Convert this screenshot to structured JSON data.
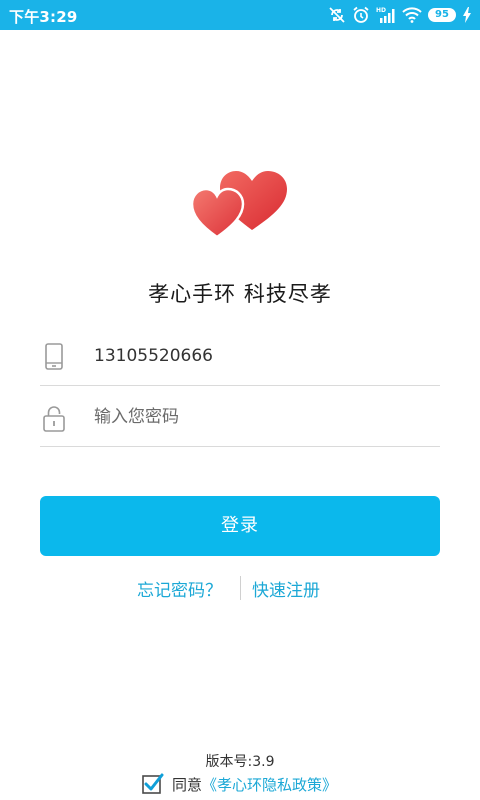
{
  "status_bar": {
    "time": "下午3:29",
    "battery": "95",
    "icons": [
      "sync-off-icon",
      "alarm-icon",
      "hd-signal-icon",
      "wifi-icon",
      "battery-icon",
      "charging-icon"
    ]
  },
  "logo": {
    "icon": "double-heart-logo-icon"
  },
  "slogan": "孝心手环 科技尽孝",
  "phone_field": {
    "icon": "phone-icon",
    "value": "13105520666"
  },
  "password_field": {
    "icon": "lock-icon",
    "placeholder": "输入您密码"
  },
  "login_button": {
    "label": "登录"
  },
  "links": {
    "forgot": "忘记密码？",
    "register": "快速注册"
  },
  "footer": {
    "version": "版本号:3.9",
    "agree_label": "同意",
    "policy_link": "《孝心环隐私政策》",
    "agree_checked": true
  },
  "colors": {
    "status_bar": "#1ab3e8",
    "accent": "#0bb8ec",
    "link": "#1ca8d6",
    "heart": "#e8403f"
  }
}
